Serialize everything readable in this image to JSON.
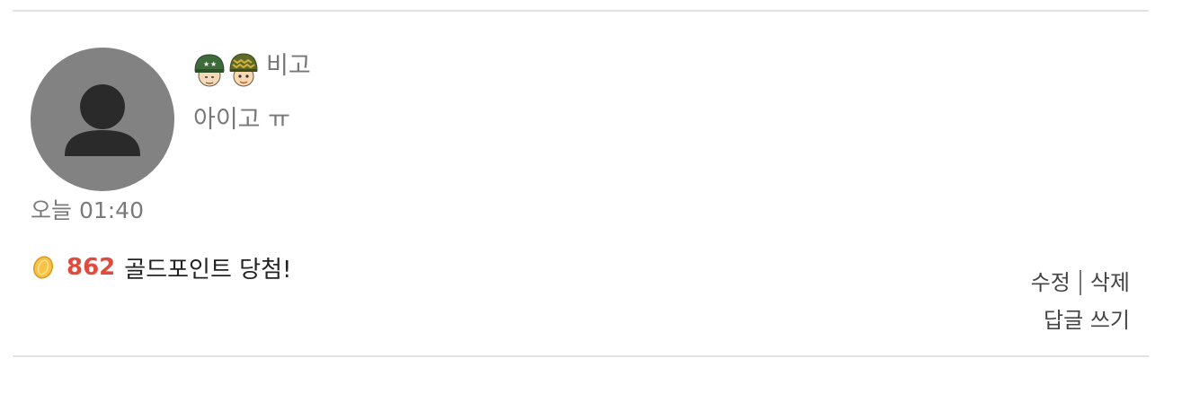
{
  "comment": {
    "username": "비고",
    "text": "아이고 ㅠ",
    "timestamp": "오늘 01:40",
    "points": {
      "value": "862",
      "label": "골드포인트 당첨!"
    },
    "actions": {
      "edit": "수정",
      "delete": "삭제",
      "reply": "답글 쓰기"
    },
    "badges": [
      "soldier-helmet-icon",
      "camo-soldier-icon"
    ]
  },
  "colors": {
    "points_accent": "#e24a3e",
    "avatar_bg": "#828282",
    "divider": "#e2e2e2"
  }
}
